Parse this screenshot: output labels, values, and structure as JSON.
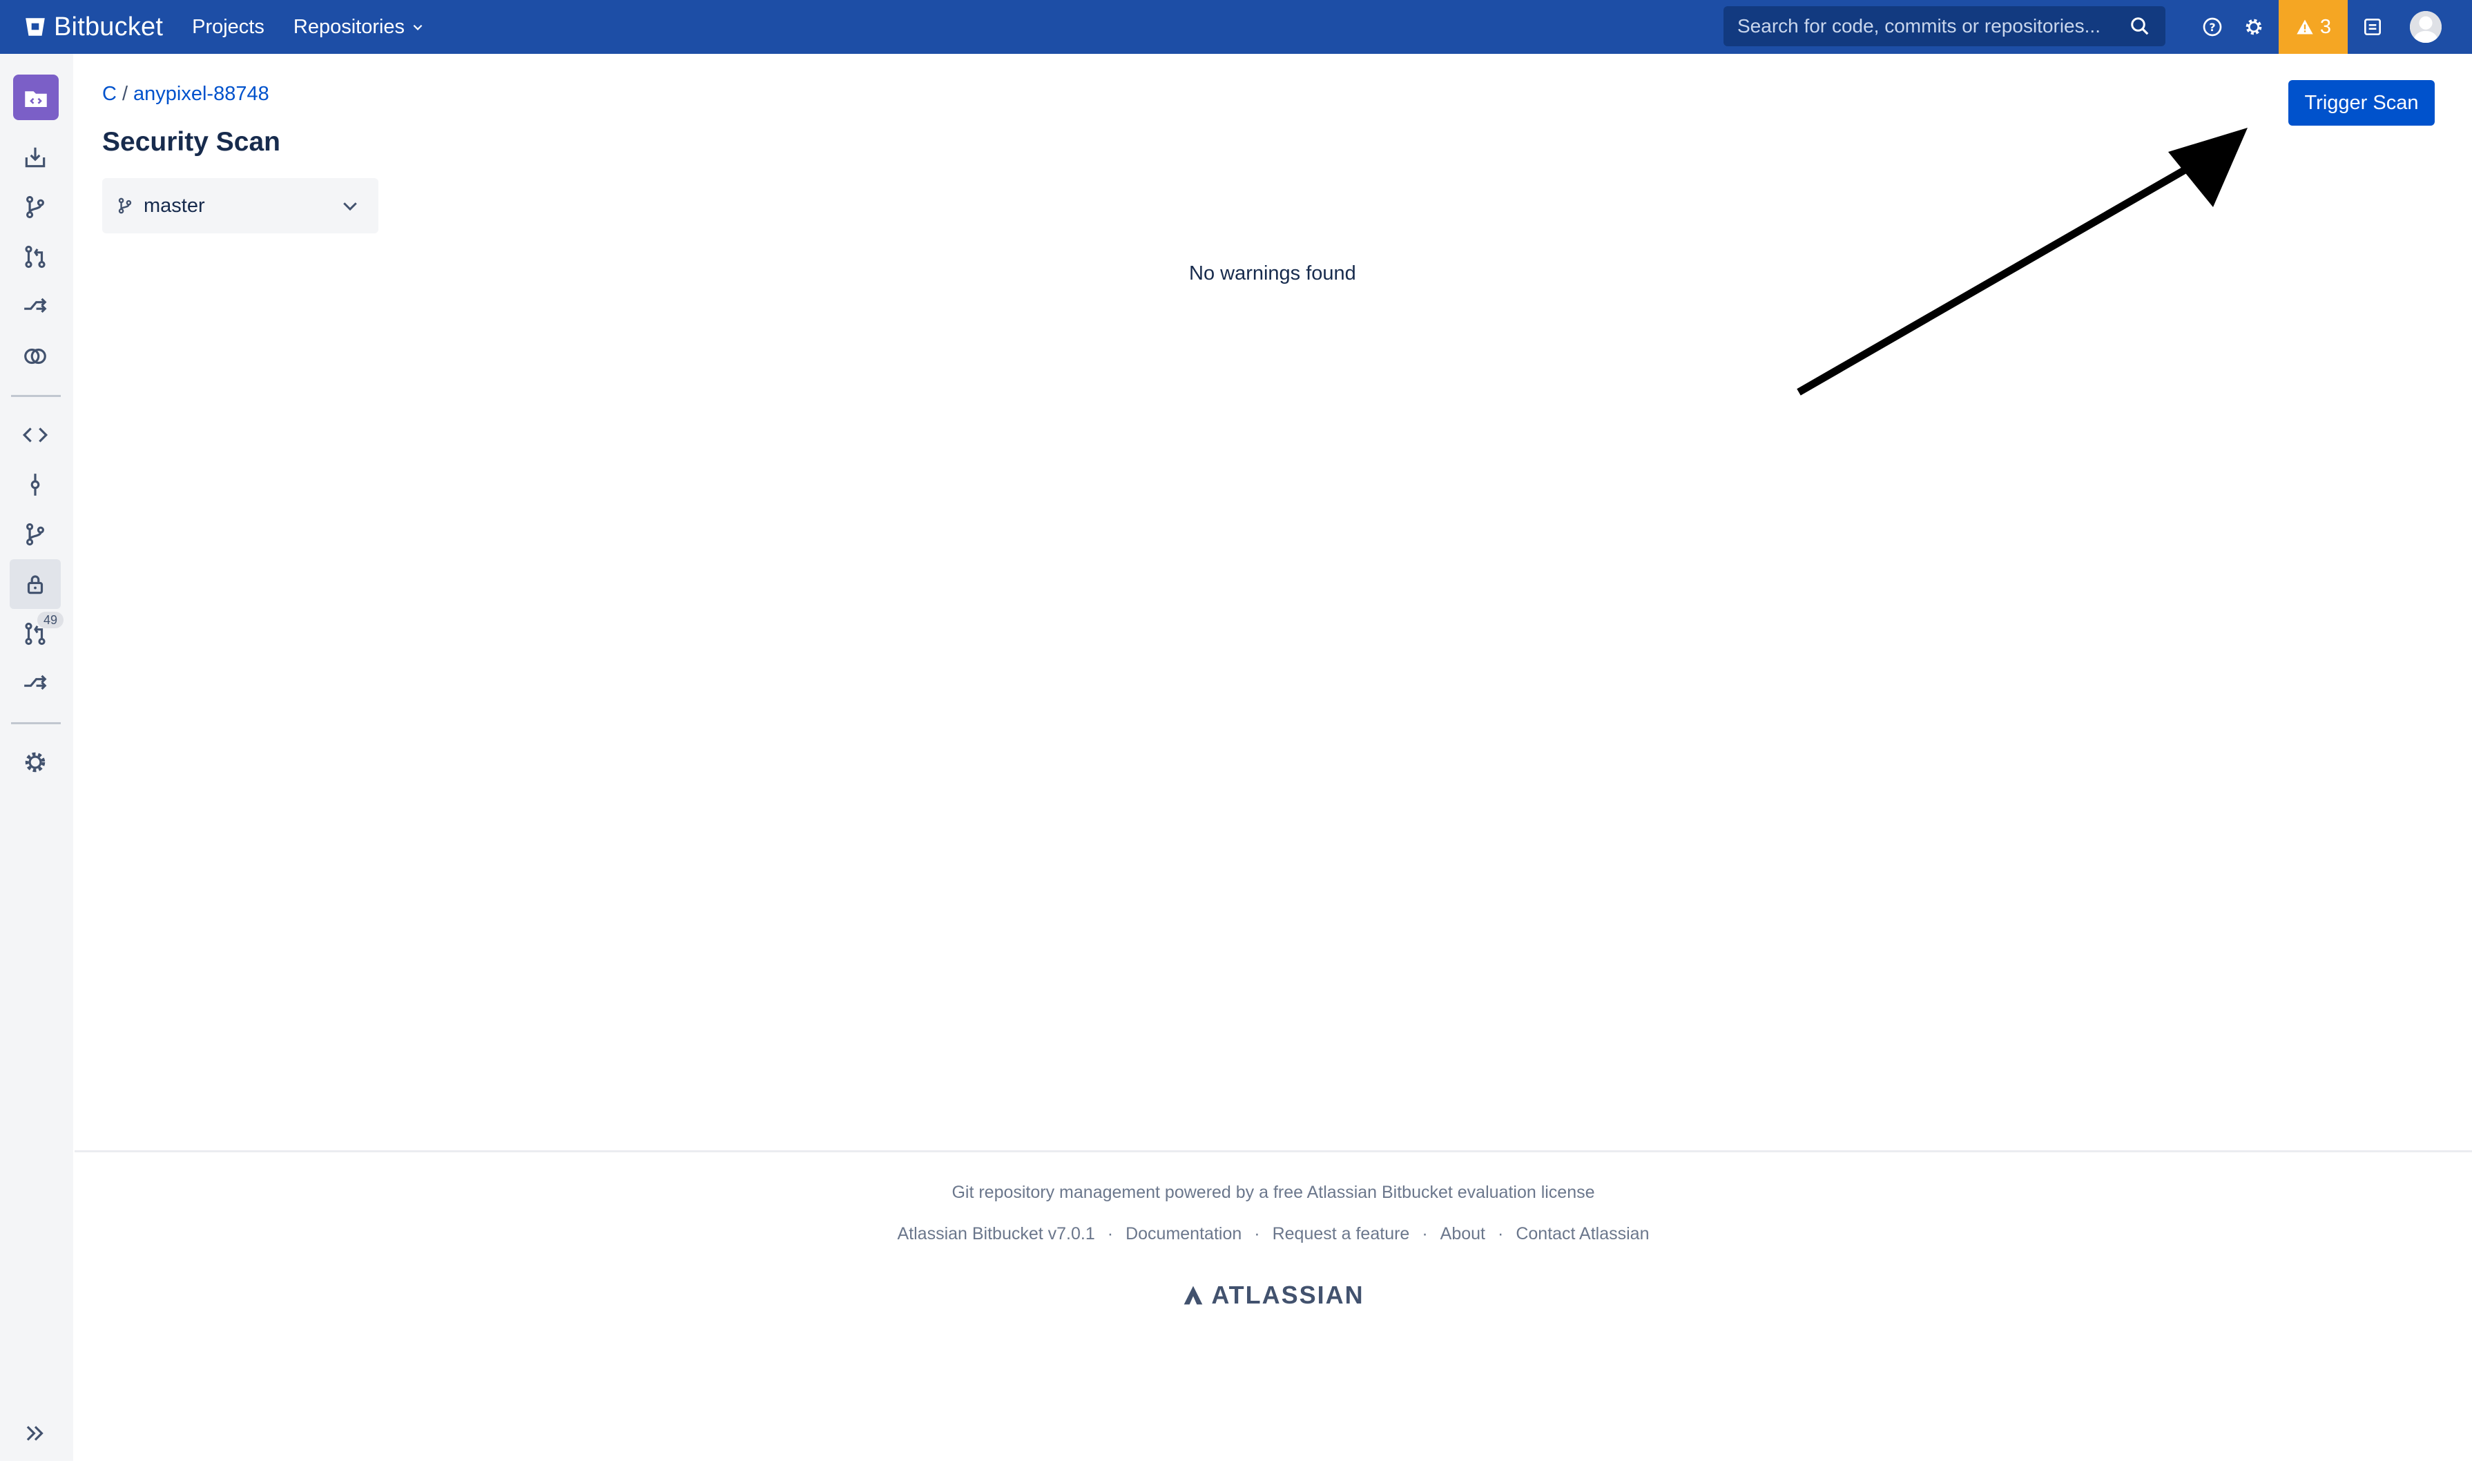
{
  "colors": {
    "topnav": "#1d4ea6",
    "accent": "#0052cc",
    "alert": "#f5a623",
    "repo_avatar": "#7b5fc7"
  },
  "topnav": {
    "brand": "Bitbucket",
    "projects": "Projects",
    "repositories": "Repositories",
    "search_placeholder": "Search for code, commits or repositories...",
    "alert_count": "3"
  },
  "sidebar": {
    "icons": [
      "repo-avatar-icon",
      "clone-icon",
      "create-branch-icon",
      "create-pull-request-icon",
      "fork-icon",
      "compare-icon",
      "source-icon",
      "commits-icon",
      "branches-icon",
      "lock-icon",
      "pull-requests-icon",
      "forks-icon",
      "settings-icon",
      "expand-icon"
    ],
    "pull_requests_badge": "49"
  },
  "breadcrumb": {
    "project": "C",
    "separator": "/",
    "repo": "anypixel-88748"
  },
  "page": {
    "title": "Security Scan",
    "branch": "master",
    "message": "No warnings found",
    "trigger_button": "Trigger Scan"
  },
  "footer": {
    "license": "Git repository management powered by a free Atlassian Bitbucket evaluation license",
    "links": [
      "Atlassian Bitbucket v7.0.1",
      "Documentation",
      "Request a feature",
      "About",
      "Contact Atlassian"
    ],
    "logo": "ATLASSIAN"
  }
}
